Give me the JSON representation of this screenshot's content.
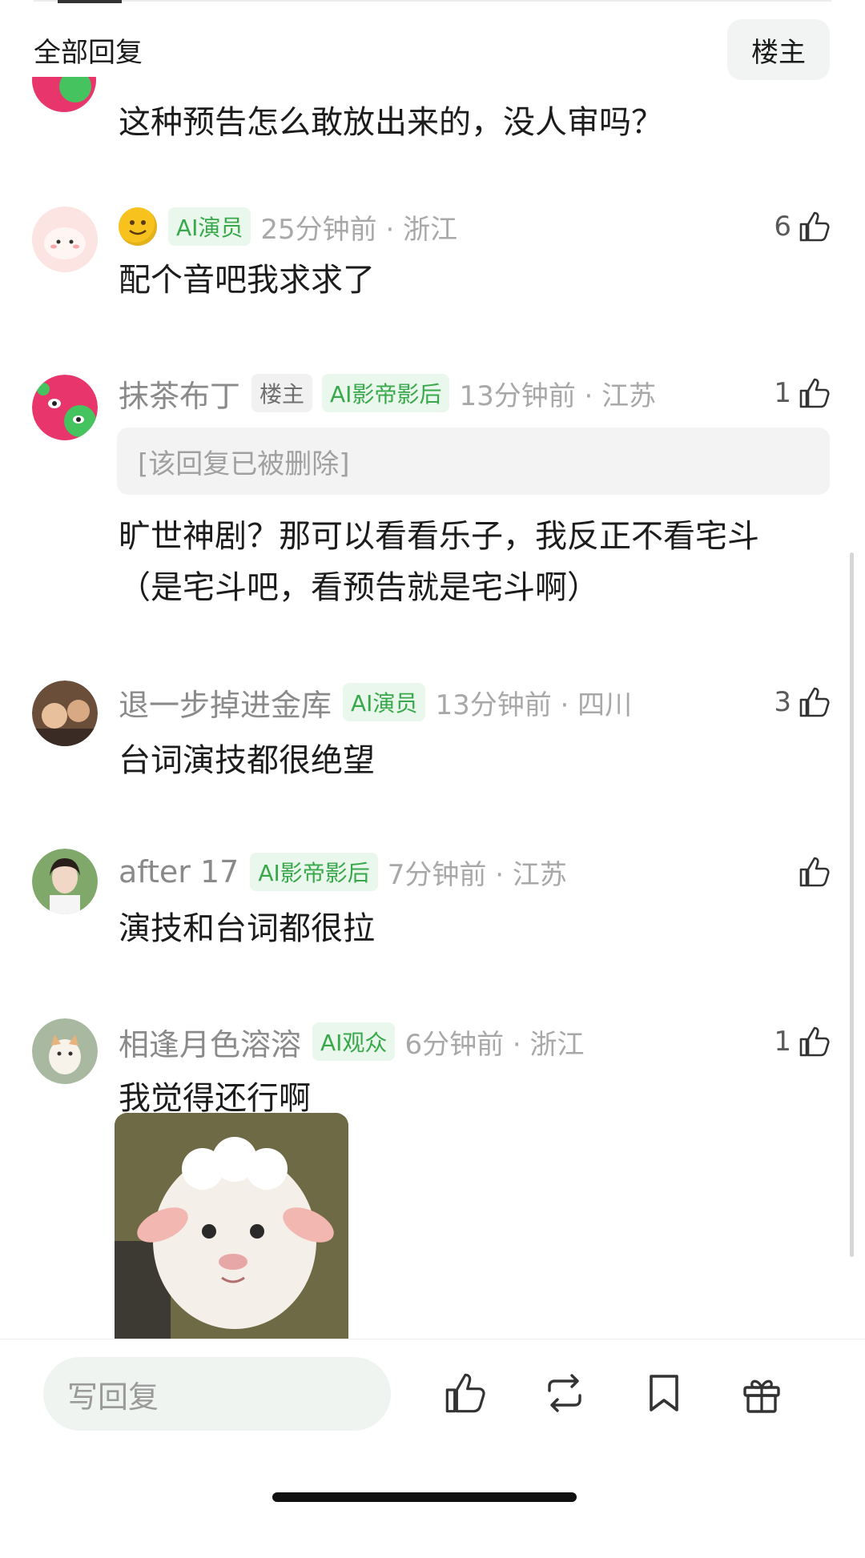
{
  "header": {
    "title": "全部回复",
    "owner_button": "楼主"
  },
  "previous_comment": {
    "text": "这种预告怎么敢放出来的，没人审吗？"
  },
  "comments": [
    {
      "name": "",
      "badge": "AI演员",
      "time": "25分钟前 · 浙江",
      "likes": "6",
      "text": "配个音吧我求求了"
    },
    {
      "name": "抹茶布丁",
      "owner_badge": "楼主",
      "badge": "AI影帝影后",
      "time": "13分钟前 · 江苏",
      "likes": "1",
      "deleted_reply": "[该回复已被删除]",
      "text": "旷世神剧？那可以看看乐子，我反正不看宅斗（是宅斗吧，看预告就是宅斗啊）"
    },
    {
      "name": "退一步掉进金库",
      "badge": "AI演员",
      "time": "13分钟前 · 四川",
      "likes": "3",
      "text": "台词演技都很绝望"
    },
    {
      "name": "after 17",
      "badge": "AI影帝影后",
      "time": "7分钟前 · 江苏",
      "likes": "",
      "text": "演技和台词都很拉"
    },
    {
      "name": "相逢月色溶溶",
      "badge": "AI观众",
      "time": "6分钟前 · 浙江",
      "likes": "1",
      "text": "我觉得还行啊"
    }
  ],
  "bottom_bar": {
    "reply_placeholder": "写回复"
  },
  "colors": {
    "badge_green": "#38a84a",
    "badge_bg": "#eaf7ec",
    "meta_gray": "#a8a8a8"
  },
  "icons": [
    "thumbs-up-icon",
    "repost-icon",
    "bookmark-icon",
    "gift-icon"
  ]
}
